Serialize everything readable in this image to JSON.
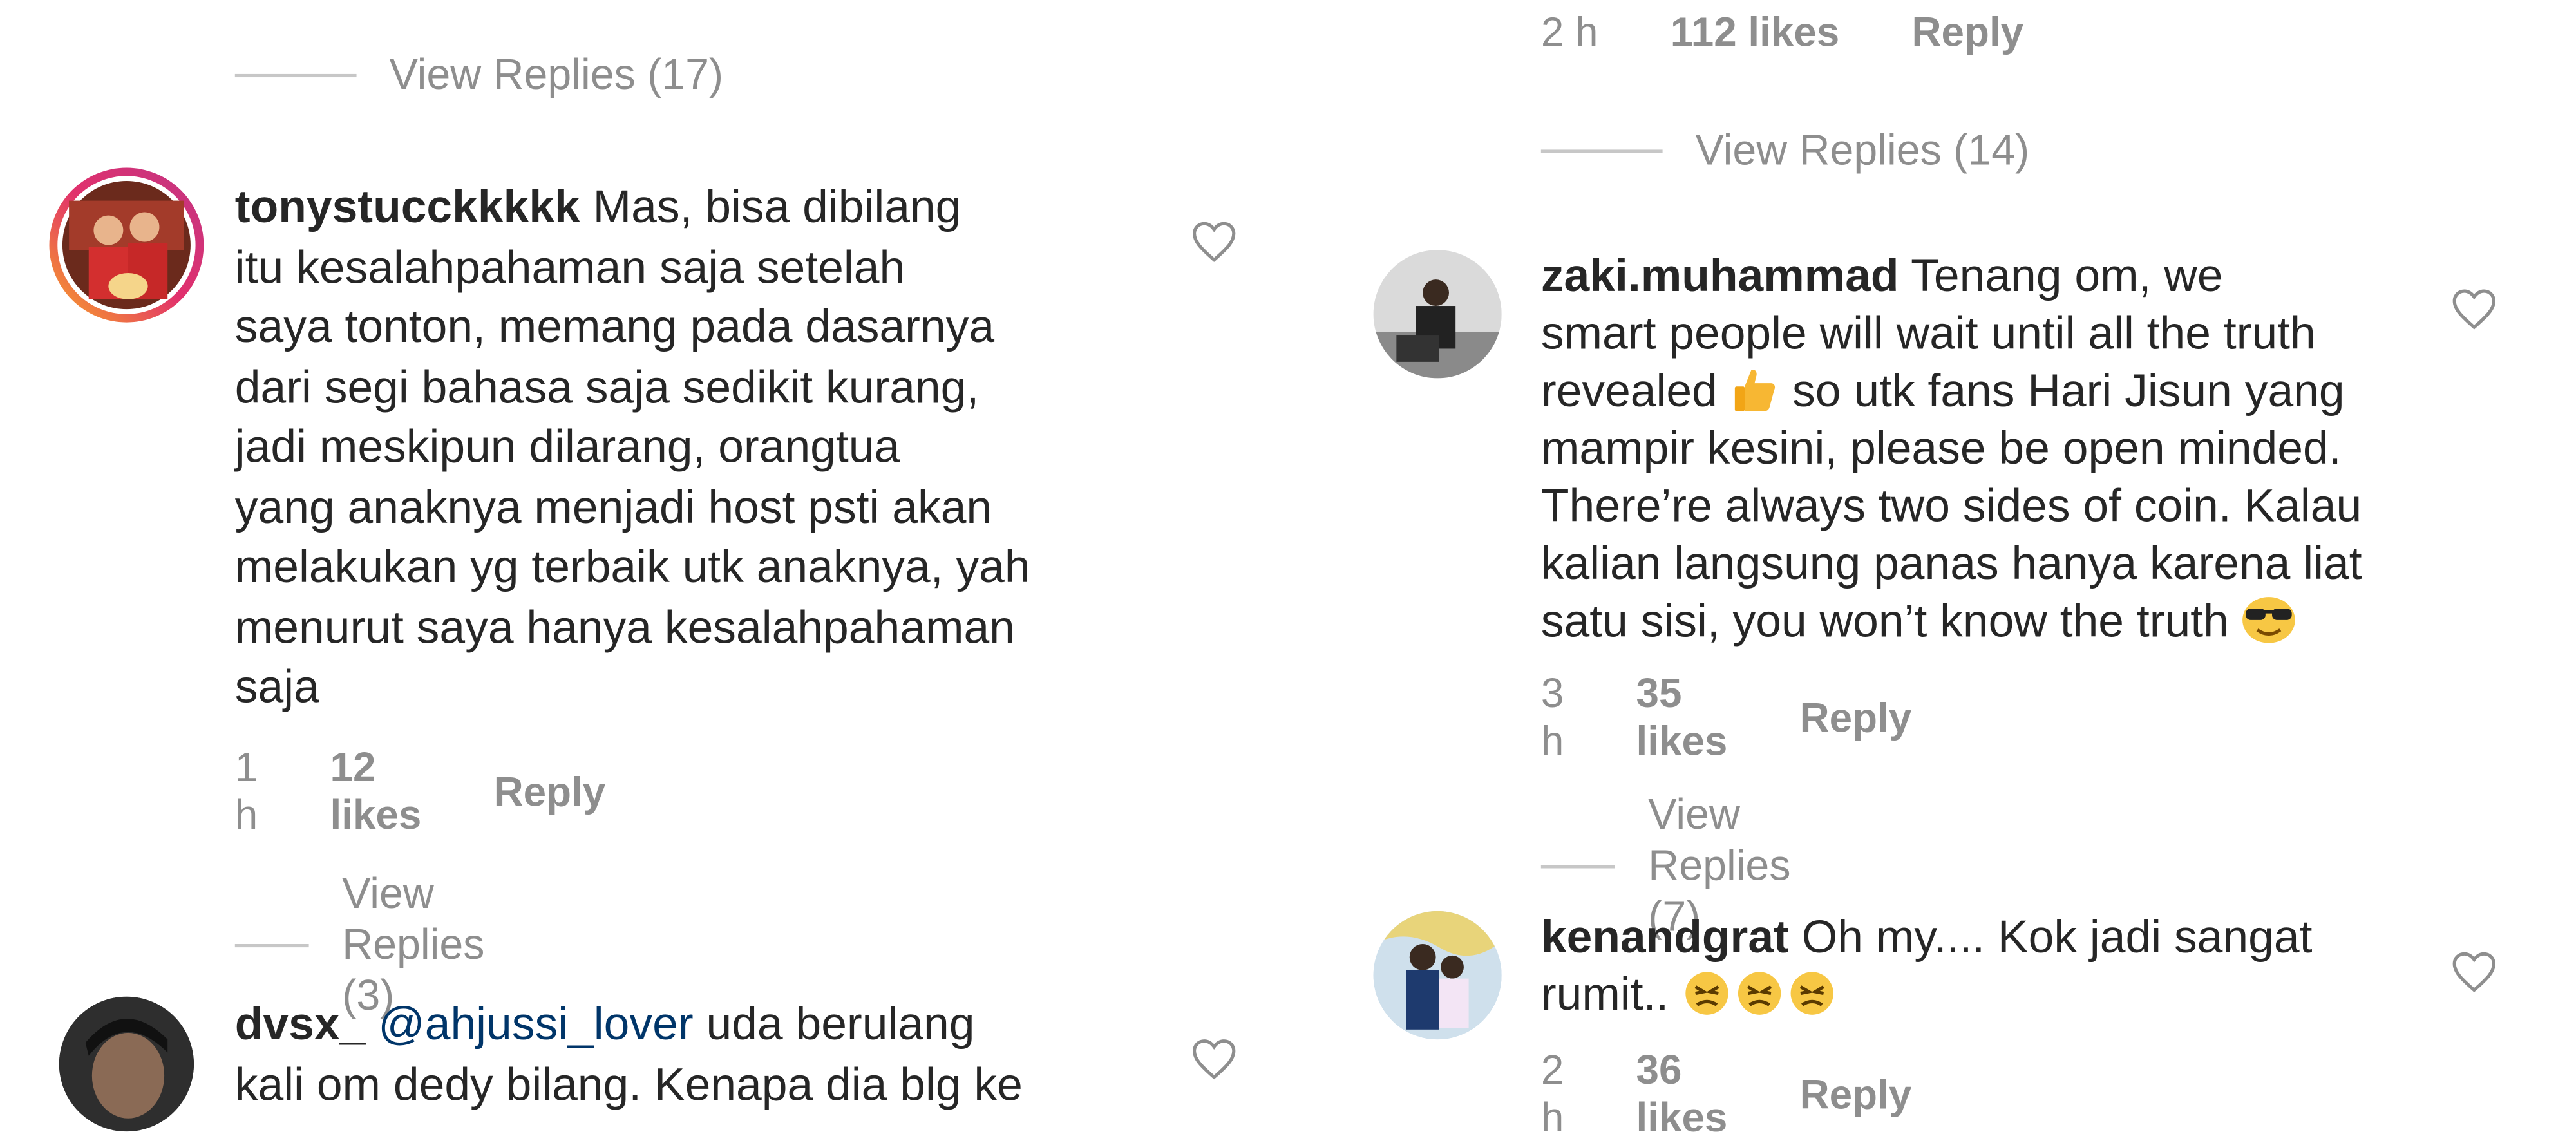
{
  "left": {
    "top_view_replies": "View Replies (17)",
    "comment1": {
      "username": "tonystucckkkkk",
      "text": "Mas, bisa dibilang",
      "lines": [
        "itu kesalahpahaman saja setelah",
        "saya tonton, memang pada dasarnya",
        "dari segi bahasa saja sedikit kurang,",
        "jadi meskipun dilarang, orangtua",
        "yang anaknya menjadi host psti akan",
        "melakukan yg terbaik utk anaknya, yah",
        "menurut saya hanya kesalahpahaman",
        "saja"
      ],
      "time": "1 h",
      "likes": "12 likes",
      "reply": "Reply",
      "view_replies": "View Replies (3)",
      "avatar_icon": "user-avatar-photo"
    },
    "comment2": {
      "username": "dvsx_",
      "mention": "@ahjussi_lover",
      "text_after_mention": "uda berulang",
      "line2": "kali om dedy bilang. Kenapa dia blg ke",
      "avatar_icon": "user-avatar-photo"
    }
  },
  "right": {
    "top_meta": {
      "time": "2 h",
      "likes": "112 likes",
      "reply": "Reply"
    },
    "top_view_replies": "View Replies (14)",
    "comment1": {
      "username": "zaki.muhammad",
      "text": "Tenang om, we",
      "line2": "smart people will wait until all the truth",
      "line3_a": "revealed",
      "line3_b": "so utk fans Hari Jisun yang",
      "line4": "mampir kesini, please be open minded.",
      "line5": "There’re always two sides of coin. Kalau",
      "line6": "kalian langsung panas hanya karena liat",
      "line7": "satu sisi, you won’t know the truth",
      "emoji1": "thumbs-up-emoji",
      "emoji2": "sunglasses-emoji",
      "time": "3 h",
      "likes": "35 likes",
      "reply": "Reply",
      "view_replies": "View Replies (7)"
    },
    "comment2": {
      "username": "kenandgrat",
      "text": "Oh my.... Kok jadi sangat",
      "line2": "rumit..",
      "emoji": "persevering-face-emoji",
      "time": "2 h",
      "likes": "36 likes",
      "reply": "Reply"
    }
  },
  "colors": {
    "primary_text": "#262626",
    "secondary_text": "#8e8e8e",
    "mention": "#003569",
    "divider": "#c7c7c7"
  }
}
